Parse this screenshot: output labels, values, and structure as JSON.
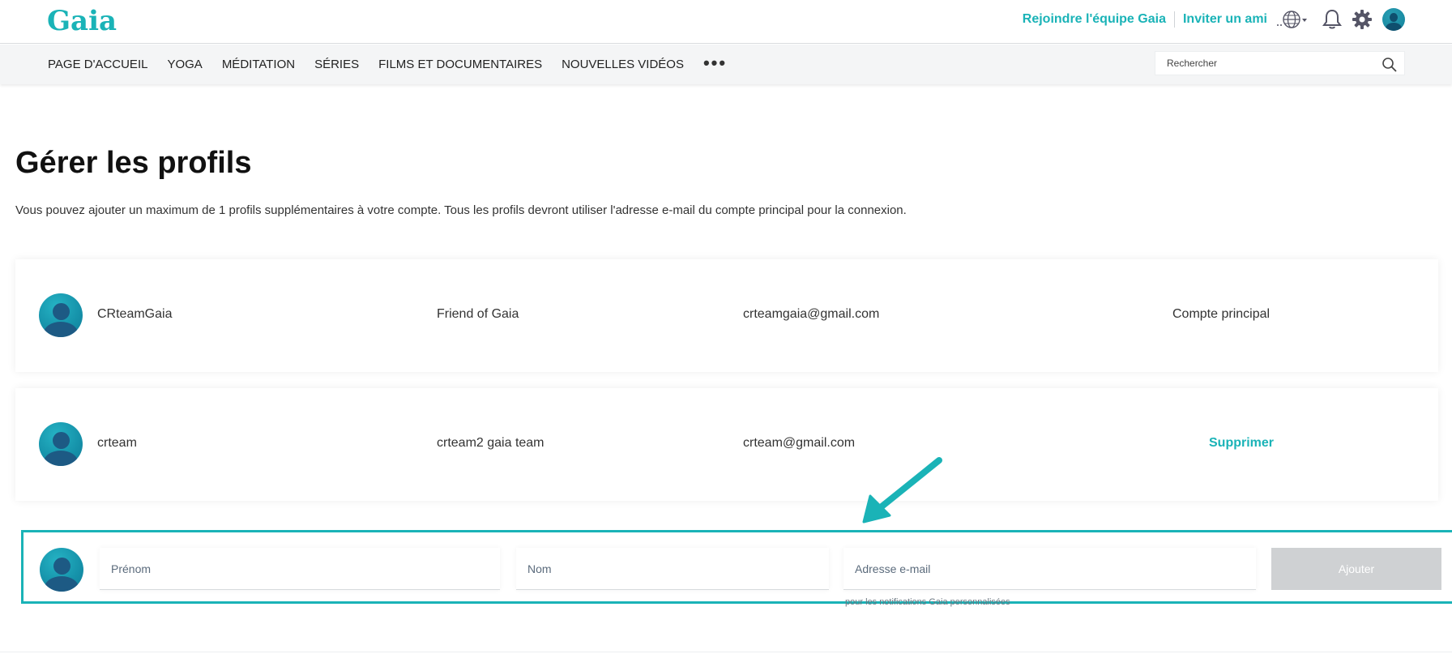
{
  "header": {
    "logo": "Gaia",
    "links": {
      "join": "Rejoindre l'équipe Gaia",
      "invite": "Inviter un ami"
    },
    "icons": {
      "language": "globe-icon",
      "notifications": "bell-icon",
      "settings": "gear-icon",
      "profile": "avatar"
    }
  },
  "nav": {
    "items": [
      "PAGE D'ACCUEIL",
      "YOGA",
      "MÉDITATION",
      "SÉRIES",
      "FILMS ET DOCUMENTAIRES",
      "NOUVELLES VIDÉOS"
    ],
    "more": "•••",
    "search": {
      "placeholder": "Rechercher"
    }
  },
  "main": {
    "title": "Gérer les profils",
    "description": "Vous pouvez ajouter un maximum de 1 profils supplémentaires à votre compte. Tous les profils devront utiliser l'adresse e-mail du compte principal pour la connexion.",
    "profiles": [
      {
        "username": "CRteamGaia",
        "name": "Friend of Gaia",
        "email": "crteamgaia@gmail.com",
        "action": "Compte principal"
      },
      {
        "username": "crteam",
        "name": "crteam2 gaia team",
        "email": "crteam@gmail.com",
        "action": "Supprimer"
      }
    ],
    "add_form": {
      "first_name_placeholder": "Prénom",
      "last_name_placeholder": "Nom",
      "email_placeholder": "Adresse e-mail",
      "submit_label": "Ajouter",
      "email_hint": "pour les notifications Gaia personnalisées"
    }
  },
  "colors": {
    "accent": "#1ab3b7",
    "nav_bg": "#f4f5f6",
    "button_disabled": "#cfd1d3"
  }
}
